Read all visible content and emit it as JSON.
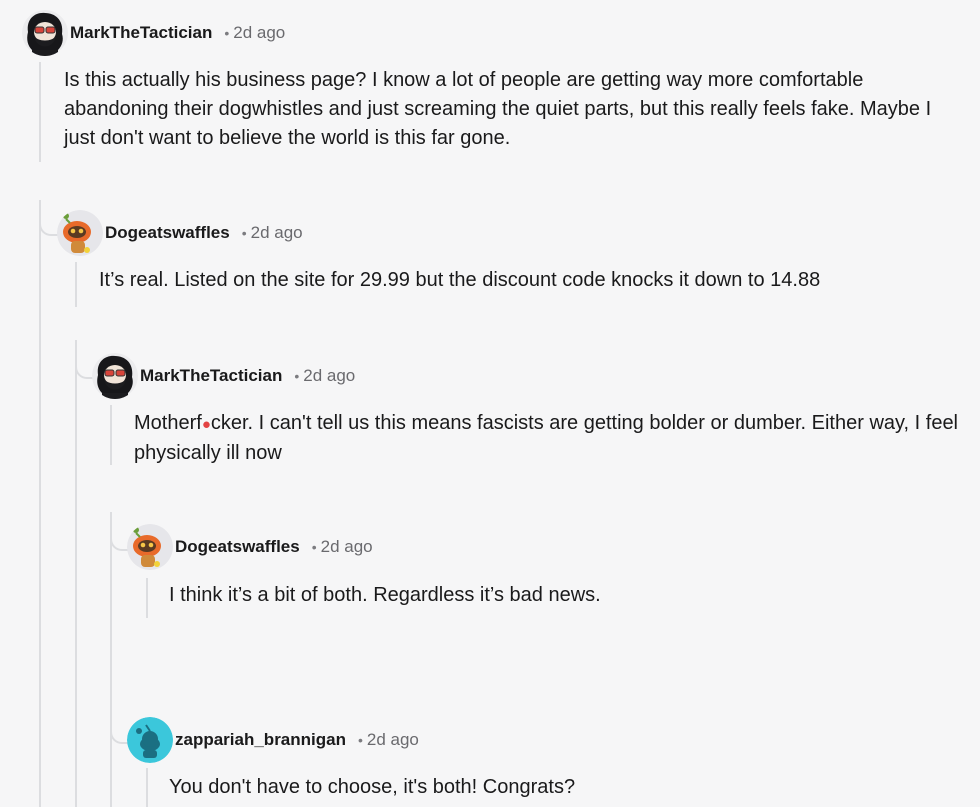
{
  "comments": [
    {
      "username": "MarkTheTactician",
      "separator": "•",
      "time": "2d ago",
      "body": "Is this actually his business page? I know a lot of people are getting way more comfortable abandoning their dogwhistles and just screaming the quiet parts, but this really feels fake. Maybe I just don't want to believe the world is this far gone.",
      "avatar_icon": "bearded-man-avatar-icon"
    },
    {
      "username": "Dogeatswaffles",
      "separator": "•",
      "time": "2d ago",
      "body": "It’s real. Listed on the site for 29.99 but the discount code knocks it down to 14.88",
      "avatar_icon": "robot-snoo-avatar-icon"
    },
    {
      "username": "MarkTheTactician",
      "separator": "•",
      "time": "2d ago",
      "body_pre": "Motherf",
      "body_redact": "●",
      "body_post": "cker. I can't tell us this means fascists are getting bolder or dumber. Either way, I feel physically ill now",
      "avatar_icon": "bearded-man-avatar-icon"
    },
    {
      "username": "Dogeatswaffles",
      "separator": "•",
      "time": "2d ago",
      "body": "I think it’s a bit of both. Regardless it’s bad news.",
      "avatar_icon": "robot-snoo-avatar-icon"
    },
    {
      "username": "zappariah_brannigan",
      "separator": "•",
      "time": "2d ago",
      "body": "You don't have to choose, it's both! Congrats?",
      "avatar_icon": "default-snoo-avatar-icon"
    }
  ],
  "colors": {
    "background": "#f6f6f7",
    "thread_line": "#dcdde0",
    "default_avatar": "#3bc7db"
  }
}
